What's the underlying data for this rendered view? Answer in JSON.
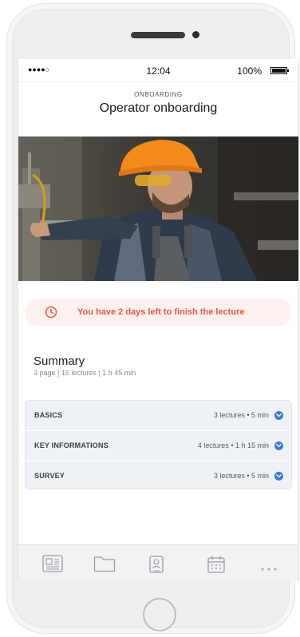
{
  "status_bar": {
    "signal": "●●●●○",
    "time": "12:04",
    "battery": "100%"
  },
  "header": {
    "eyebrow": "ONBOARDING",
    "title": "Operator onboarding"
  },
  "hero": {
    "image": "worker-in-hard-hat-photo"
  },
  "deadline": {
    "icon": "clock-icon",
    "text": "You have 2 days left to finish the lecture",
    "color": "#e4584e",
    "background": "#fdf1ef"
  },
  "summary": {
    "title": "Summary",
    "meta": "3 page | 16 lectures | 1 h 45 min"
  },
  "sections": [
    {
      "name": "BASICS",
      "meta": "3 lectures • 5 min"
    },
    {
      "name": "KEY INFORMATIONS",
      "meta": "4 lectures • 1 h 15 min"
    },
    {
      "name": "SURVEY",
      "meta": "3 lectures • 5 min"
    }
  ],
  "tabbar": {
    "items": [
      "newspaper-icon",
      "folder-icon",
      "badge-icon",
      "calendar-icon",
      "more-icon"
    ]
  },
  "colors": {
    "accent": "#3b7dd8",
    "alert": "#e4584e",
    "section_bg": "#eef1f6"
  }
}
